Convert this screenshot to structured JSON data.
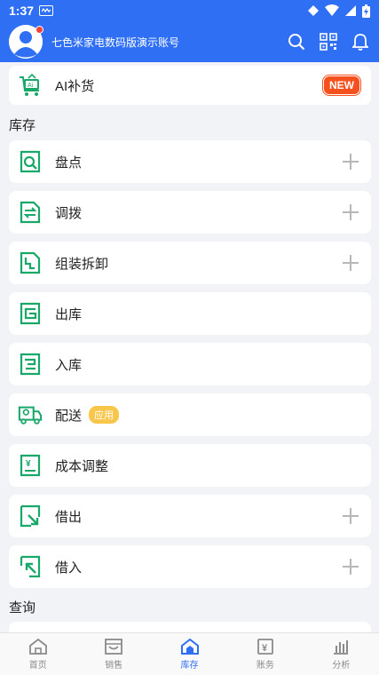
{
  "status_bar": {
    "time": "1:37"
  },
  "header": {
    "account_name": "七色米家电数码版演示账号"
  },
  "ai_card": {
    "label": "AI补货",
    "badge": "NEW"
  },
  "sections": [
    {
      "title": "库存"
    },
    {
      "title": "查询"
    }
  ],
  "inventory_items": [
    {
      "label": "盘点",
      "icon": "magnify-doc-icon",
      "has_add": true
    },
    {
      "label": "调拨",
      "icon": "transfer-doc-icon",
      "has_add": true
    },
    {
      "label": "组装拆卸",
      "icon": "assemble-doc-icon",
      "has_add": true
    },
    {
      "label": "出库",
      "icon": "outbound-doc-icon",
      "has_add": false
    },
    {
      "label": "入库",
      "icon": "inbound-doc-icon",
      "has_add": false
    },
    {
      "label": "配送",
      "icon": "delivery-truck-icon",
      "has_add": false,
      "badge": "应用"
    },
    {
      "label": "成本调整",
      "icon": "cost-adjust-icon",
      "has_add": false
    },
    {
      "label": "借出",
      "icon": "lend-out-icon",
      "has_add": true
    },
    {
      "label": "借入",
      "icon": "borrow-in-icon",
      "has_add": true
    }
  ],
  "tabs": [
    {
      "label": "首页",
      "icon": "home-icon"
    },
    {
      "label": "销售",
      "icon": "store-icon"
    },
    {
      "label": "库存",
      "icon": "warehouse-icon",
      "active": true
    },
    {
      "label": "账务",
      "icon": "ledger-icon"
    },
    {
      "label": "分析",
      "icon": "analytics-icon"
    }
  ],
  "colors": {
    "primary": "#2f6ff3",
    "green": "#1aa86a",
    "new_badge": "#f4511e",
    "app_badge": "#f7c64a"
  }
}
